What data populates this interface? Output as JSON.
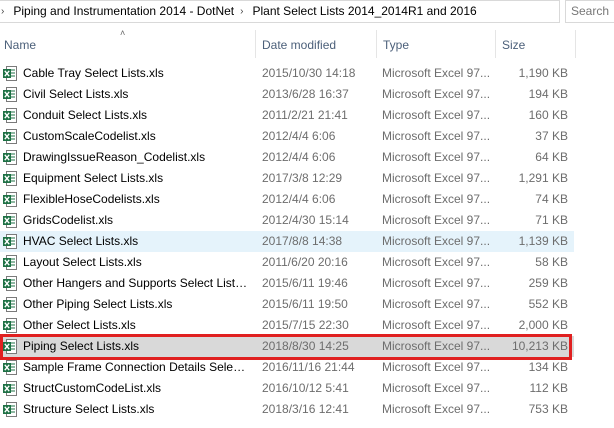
{
  "address_bar": {
    "crumbs": [
      "Piping and Instrumentation 2014 - DotNet",
      "Plant Select Lists 2014_2014R1 and 2016"
    ]
  },
  "search": {
    "placeholder": "Search"
  },
  "columns": {
    "name": "Name",
    "date": "Date modified",
    "type": "Type",
    "size": "Size"
  },
  "files": [
    {
      "name": "Cable Tray Select Lists.xls",
      "date": "2015/10/30 14:18",
      "type": "Microsoft Excel 97...",
      "size": "1,190 KB"
    },
    {
      "name": "Civil Select Lists.xls",
      "date": "2013/6/28 16:37",
      "type": "Microsoft Excel 97...",
      "size": "194 KB"
    },
    {
      "name": "Conduit Select Lists.xls",
      "date": "2011/2/21 21:41",
      "type": "Microsoft Excel 97...",
      "size": "160 KB"
    },
    {
      "name": "CustomScaleCodelist.xls",
      "date": "2012/4/4 6:06",
      "type": "Microsoft Excel 97...",
      "size": "37 KB"
    },
    {
      "name": "DrawingIssueReason_Codelist.xls",
      "date": "2012/4/4 6:06",
      "type": "Microsoft Excel 97...",
      "size": "64 KB"
    },
    {
      "name": "Equipment Select Lists.xls",
      "date": "2017/3/8 12:29",
      "type": "Microsoft Excel 97...",
      "size": "1,291 KB"
    },
    {
      "name": "FlexibleHoseCodelists.xls",
      "date": "2012/4/4 6:06",
      "type": "Microsoft Excel 97...",
      "size": "74 KB"
    },
    {
      "name": "GridsCodelist.xls",
      "date": "2012/4/30 15:14",
      "type": "Microsoft Excel 97...",
      "size": "71 KB"
    },
    {
      "name": "HVAC Select Lists.xls",
      "date": "2017/8/8 14:38",
      "type": "Microsoft Excel 97...",
      "size": "1,139 KB"
    },
    {
      "name": "Layout Select Lists.xls",
      "date": "2011/6/20 20:16",
      "type": "Microsoft Excel 97...",
      "size": "58 KB"
    },
    {
      "name": "Other Hangers and Supports Select Lists.xls",
      "date": "2015/6/11 19:46",
      "type": "Microsoft Excel 97...",
      "size": "259 KB"
    },
    {
      "name": "Other Piping Select Lists.xls",
      "date": "2015/6/11 19:50",
      "type": "Microsoft Excel 97...",
      "size": "552 KB"
    },
    {
      "name": "Other Select Lists.xls",
      "date": "2015/7/15 22:30",
      "type": "Microsoft Excel 97...",
      "size": "2,000 KB"
    },
    {
      "name": "Piping Select Lists.xls",
      "date": "2018/8/30 14:25",
      "type": "Microsoft Excel 97...",
      "size": "10,213 KB"
    },
    {
      "name": "Sample Frame Connection Details Select ...",
      "date": "2016/11/16 21:44",
      "type": "Microsoft Excel 97...",
      "size": "134 KB"
    },
    {
      "name": "StructCustomCodeList.xls",
      "date": "2016/10/12 5:41",
      "type": "Microsoft Excel 97...",
      "size": "112 KB"
    },
    {
      "name": "Structure Select Lists.xls",
      "date": "2018/3/16 12:41",
      "type": "Microsoft Excel 97...",
      "size": "753 KB"
    }
  ],
  "hover_index": 8,
  "selected_index": 13,
  "colors": {
    "hover_bg": "#e5f3fb",
    "selected_bg": "#d9d9d9",
    "highlight_border": "#e02020",
    "header_text": "#4c607a",
    "excel_green": "#1e7145"
  },
  "icons": {
    "file": "excel-file-icon",
    "separator": "chevron-right-icon",
    "sort": "sort-up-icon"
  }
}
